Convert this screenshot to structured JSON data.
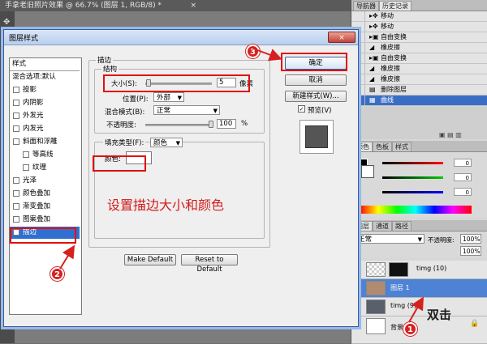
{
  "document_tab": {
    "title": "手拿老旧照片效果 @ 66.7% (图层 1, RGB/8) *",
    "close": "×"
  },
  "history_panel": {
    "tabs": [
      "导航器",
      "历史记录"
    ],
    "items": [
      "移动",
      "移动",
      "自由变换",
      "橡皮擦",
      "自由变换",
      "橡皮擦",
      "橡皮擦",
      "删除图层",
      "曲线"
    ]
  },
  "color_panel": {
    "tabs": [
      "颜色",
      "色板",
      "样式"
    ],
    "values": [
      "0",
      "0",
      "0"
    ]
  },
  "layers_panel": {
    "tabs": [
      "图层",
      "通道",
      "路径"
    ],
    "blend_mode": "正常",
    "opacity_label": "不透明度:",
    "opacity_value": "100%",
    "fill_value": "100%",
    "layers": [
      {
        "name": "timg (10)"
      },
      {
        "name": "图层 1"
      },
      {
        "name": "timg (9)"
      },
      {
        "name": "背景"
      }
    ]
  },
  "dialog": {
    "title": "图层样式",
    "close_label": "×",
    "style_list": [
      "样式",
      "混合选项:默认",
      "投影",
      "内阴影",
      "外发光",
      "内发光",
      "斜面和浮雕",
      "等高线",
      "纹理",
      "光泽",
      "颜色叠加",
      "渐变叠加",
      "图案叠加",
      "描边"
    ],
    "stroke": {
      "section_title": "描边",
      "structure_title": "结构",
      "size_label": "大小(S):",
      "size_value": "5",
      "size_unit": "像素",
      "position_label": "位置(P):",
      "position_value": "外部",
      "blend_label": "混合模式(B):",
      "blend_value": "正常",
      "opacity_label": "不透明度:",
      "opacity_value": "100",
      "opacity_unit": "%",
      "fill_type_label": "填充类型(F):",
      "fill_type_value": "颜色",
      "color_label": "颜色:",
      "make_default": "Make Default",
      "reset_default": "Reset to Default"
    },
    "buttons": {
      "ok": "确定",
      "cancel": "取消",
      "new_style": "新建样式(W)...",
      "preview": "预览(V)"
    }
  },
  "annotations": {
    "instruction_text": "设置描边大小和颜色",
    "double_click_text": "双击",
    "steps": [
      "1",
      "2",
      "3"
    ]
  }
}
